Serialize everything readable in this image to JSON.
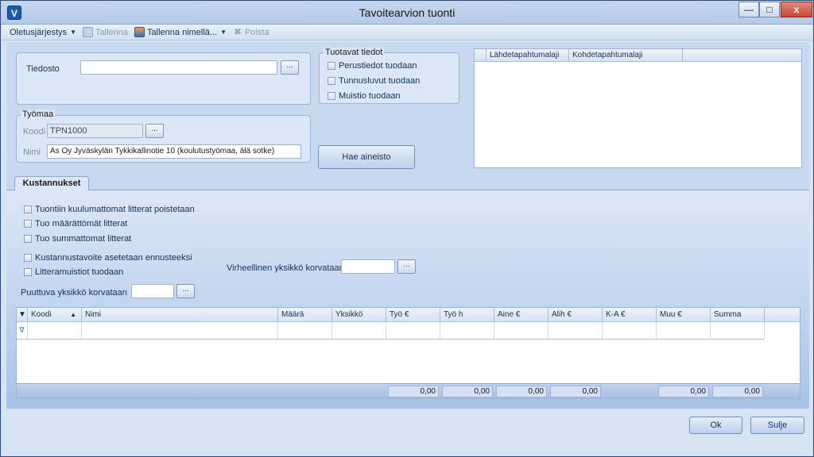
{
  "window": {
    "title": "Tavoitearvion tuonti",
    "min_glyph": "—",
    "max_glyph": "□",
    "close_glyph": "x"
  },
  "toolbar": {
    "defaults_label": "Oletusjärjestys",
    "save_label": "Tallenna",
    "save_as_label": "Tallenna nimellä...",
    "delete_label": "Poista"
  },
  "file": {
    "label": "Tiedosto",
    "value": "",
    "browse": "..."
  },
  "site": {
    "group_label": "Työmaa",
    "code_label": "Koodi",
    "code_value": "TPN1000",
    "name_label": "Nimi",
    "name_value": "As Oy Jyväskylän Tykkikallinotie 10 (koulutustyömaa, älä sotke)",
    "browse": "..."
  },
  "produced": {
    "group_label": "Tuotavat tiedot",
    "items": [
      "Perustiedot tuodaan",
      "Tunnusluvut tuodaan",
      "Muistio tuodaan"
    ]
  },
  "fetch_button": "Hae aineisto",
  "event_grid": {
    "columns": [
      "Lähdetapahtumalaji",
      "Kohdetapahtumalaji"
    ]
  },
  "tab": {
    "label": "Kustannukset"
  },
  "options": {
    "items": [
      "Tuontiin kuulumattomat litterat poistetaan",
      "Tuo määrättömät litterat",
      "Tuo summattomat litterat",
      "Kustannustavoite asetetaan ennusteeksi",
      "Litteramuistiot tuodaan"
    ]
  },
  "invalid_unit": {
    "label": "Virheellinen yksikkö korvataan",
    "value": "",
    "browse": "..."
  },
  "missing_unit": {
    "label": "Puuttuva yksikkö korvataan",
    "value": "",
    "browse": "..."
  },
  "cost_grid": {
    "columns": [
      "Koodi",
      "Nimi",
      "Määrä",
      "Yksikkö",
      "Työ €",
      "Työ h",
      "Aine €",
      "Alih €",
      "K-A €",
      "Muu €",
      "Summa"
    ],
    "totals": [
      "0,00",
      "0,00",
      "0,00",
      "0,00",
      "0,00",
      "0,00"
    ]
  },
  "buttons": {
    "ok": "Ok",
    "close": "Sulje"
  }
}
